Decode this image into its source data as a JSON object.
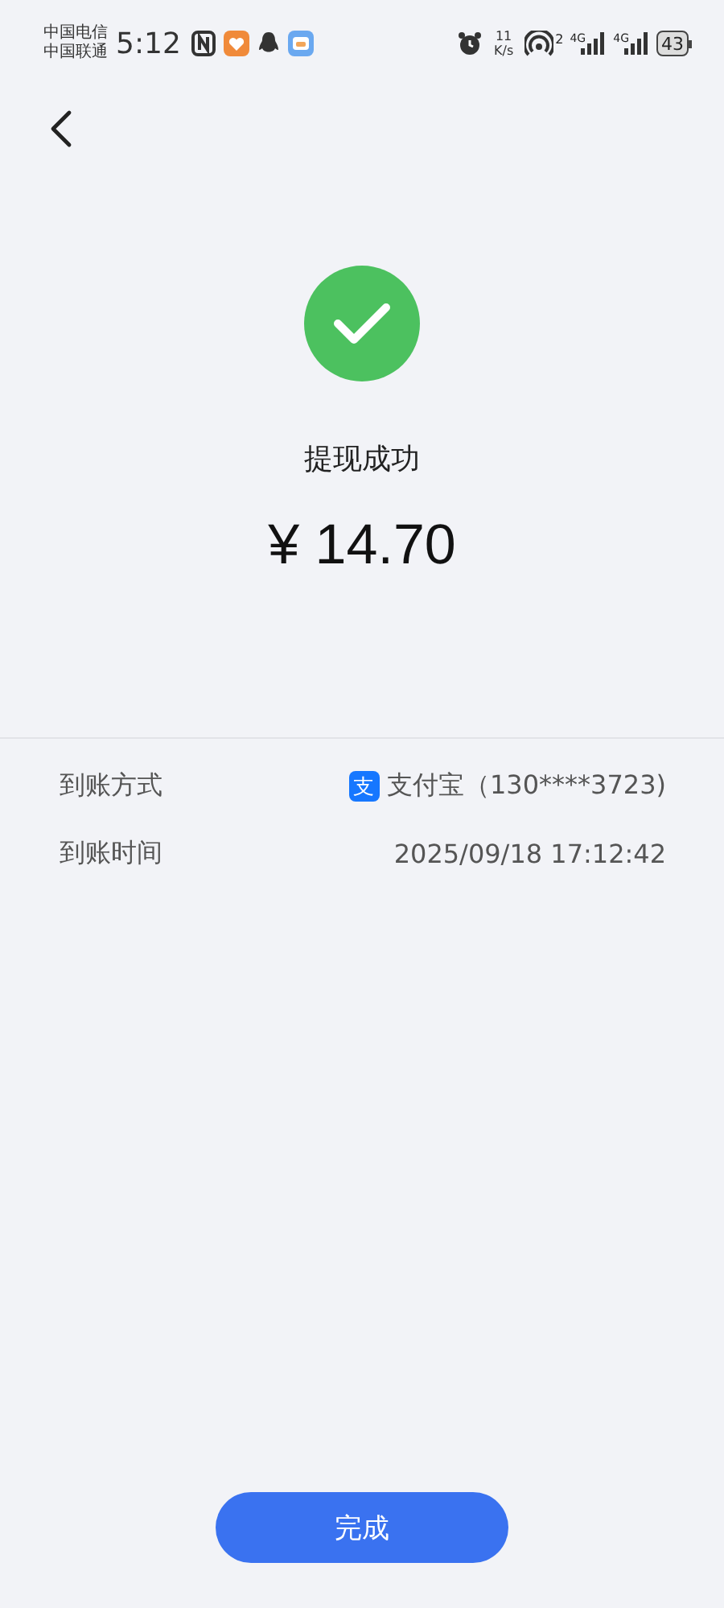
{
  "status_bar": {
    "carriers": [
      "中国电信",
      "中国联通"
    ],
    "time": "5:12",
    "net_speed": [
      "11",
      "K/s"
    ],
    "hotspot_count": "2",
    "network_labels": [
      "4G",
      "4G"
    ],
    "battery": "43"
  },
  "result": {
    "title": "提现成功",
    "amount": "¥ 14.70"
  },
  "details": [
    {
      "kind": "account",
      "label": "到账方式",
      "badge": "支",
      "value": "支付宝（130****3723)"
    },
    {
      "kind": "plain",
      "label": "到账时间",
      "value": "2025/09/18 17:12:42"
    }
  ],
  "done_button": "完成"
}
